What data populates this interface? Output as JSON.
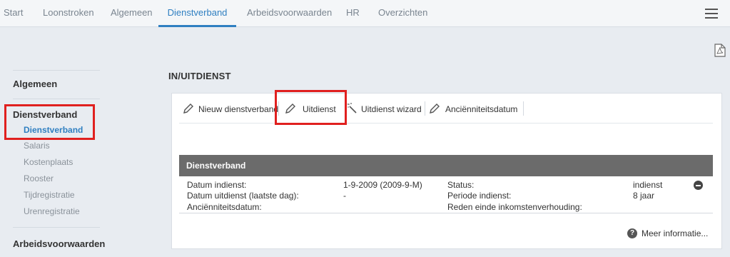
{
  "topnav": {
    "tabs": [
      "Start",
      "Loonstroken",
      "Algemeen",
      "Dienstverband",
      "Arbeidsvoorwaarden",
      "HR",
      "Overzichten"
    ],
    "active_tab": "Dienstverband",
    "menu_icon": "hamburger-icon"
  },
  "pdf_icon": "pdf-icon",
  "sidebar": {
    "sections": [
      {
        "label": "Algemeen"
      },
      {
        "label": "Dienstverband",
        "items": [
          "Dienstverband",
          "Salaris",
          "Kostenplaats",
          "Rooster",
          "Tijdregistratie",
          "Urenregistratie"
        ],
        "active_item": "Dienstverband"
      },
      {
        "label": "Arbeidsvoorwaarden"
      }
    ]
  },
  "main": {
    "section_title": "IN/UITDIENST",
    "toolbar": [
      {
        "label": "Nieuw dienstverband",
        "icon": "pencil-icon"
      },
      {
        "label": "Uitdienst",
        "icon": "pencil-icon"
      },
      {
        "label": "Uitdienst wizard",
        "icon": "magic-wand-icon"
      },
      {
        "label": "Anciënniteitsdatum",
        "icon": "pencil-icon"
      }
    ],
    "dienstverband": {
      "header": "Dienstverband",
      "left": [
        {
          "label": "Datum indienst:",
          "value": "1-9-2009 (2009-9-M)"
        },
        {
          "label": "Datum uitdienst (laatste dag):",
          "value": "-"
        },
        {
          "label": "Anciënniteitsdatum:",
          "value": ""
        }
      ],
      "right": [
        {
          "label": "Status:",
          "value": "indienst"
        },
        {
          "label": "Periode indienst:",
          "value": "8 jaar"
        },
        {
          "label": "Reden einde inkomstenverhouding:",
          "value": ""
        }
      ]
    },
    "more_info": "Meer informatie..."
  },
  "highlight_color": "#e0201f",
  "accent_color": "#2f7fc1"
}
